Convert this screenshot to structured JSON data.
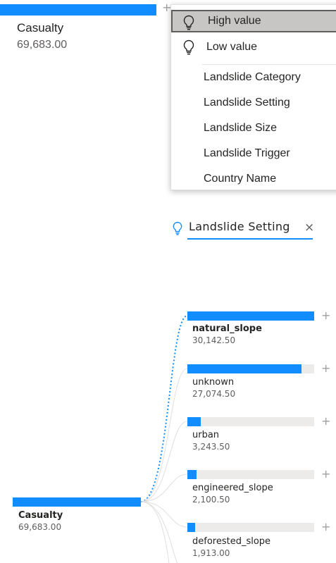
{
  "top_card": {
    "label": "Casualty",
    "value": "69,683.00"
  },
  "menu": {
    "items": [
      {
        "label": "High value",
        "icon": "lightbulb-icon",
        "selected": true
      },
      {
        "label": "Low value",
        "icon": "lightbulb-icon",
        "selected": false
      },
      {
        "label": "Landslide Category"
      },
      {
        "label": "Landslide Setting"
      },
      {
        "label": "Landslide Size"
      },
      {
        "label": "Landslide Trigger"
      },
      {
        "label": "Country Name"
      }
    ]
  },
  "chip": {
    "label": "Landslide Setting",
    "close": "×",
    "icon": "lightbulb-icon"
  },
  "tree": {
    "root": {
      "label": "Casualty",
      "value": "69,683.00"
    },
    "plus": "+",
    "nodes": [
      {
        "label": "natural_slope",
        "value": "30,142.50",
        "fraction": 1.0,
        "bold": true
      },
      {
        "label": "unknown",
        "value": "27,074.50",
        "fraction": 0.898
      },
      {
        "label": "urban",
        "value": "3,243.50",
        "fraction": 0.108
      },
      {
        "label": "engineered_slope",
        "value": "2,100.50",
        "fraction": 0.07
      },
      {
        "label": "deforested_slope",
        "value": "1,913.00",
        "fraction": 0.063
      }
    ]
  },
  "colors": {
    "accent": "#118dff",
    "track": "#ecebea",
    "selected_bg": "#c8c6c4"
  }
}
